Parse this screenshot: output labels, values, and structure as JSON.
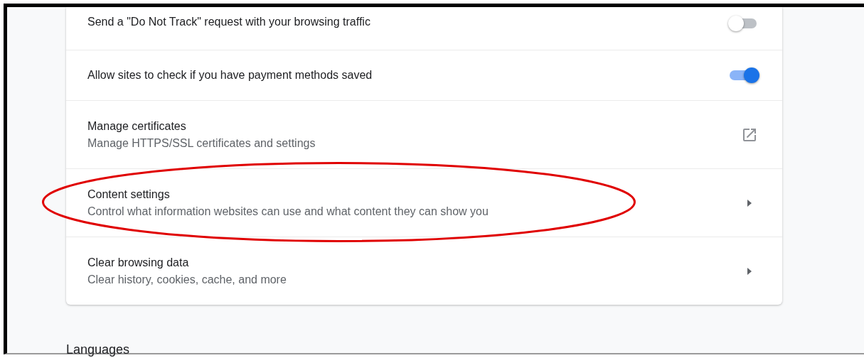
{
  "rows": [
    {
      "kind": "toggle",
      "title": "Send a \"Do Not Track\" request with your browsing traffic",
      "on": false,
      "highlighted": false
    },
    {
      "kind": "toggle",
      "title": "Allow sites to check if you have payment methods saved",
      "on": true,
      "highlighted": false
    },
    {
      "kind": "external",
      "title": "Manage certificates",
      "subtitle": "Manage HTTPS/SSL certificates and settings",
      "highlighted": false
    },
    {
      "kind": "submenu",
      "title": "Content settings",
      "subtitle": "Control what information websites can use and what content they can show you",
      "highlighted": true
    },
    {
      "kind": "submenu",
      "title": "Clear browsing data",
      "subtitle": "Clear history, cookies, cache, and more",
      "highlighted": false
    }
  ],
  "section_heading": "Languages"
}
